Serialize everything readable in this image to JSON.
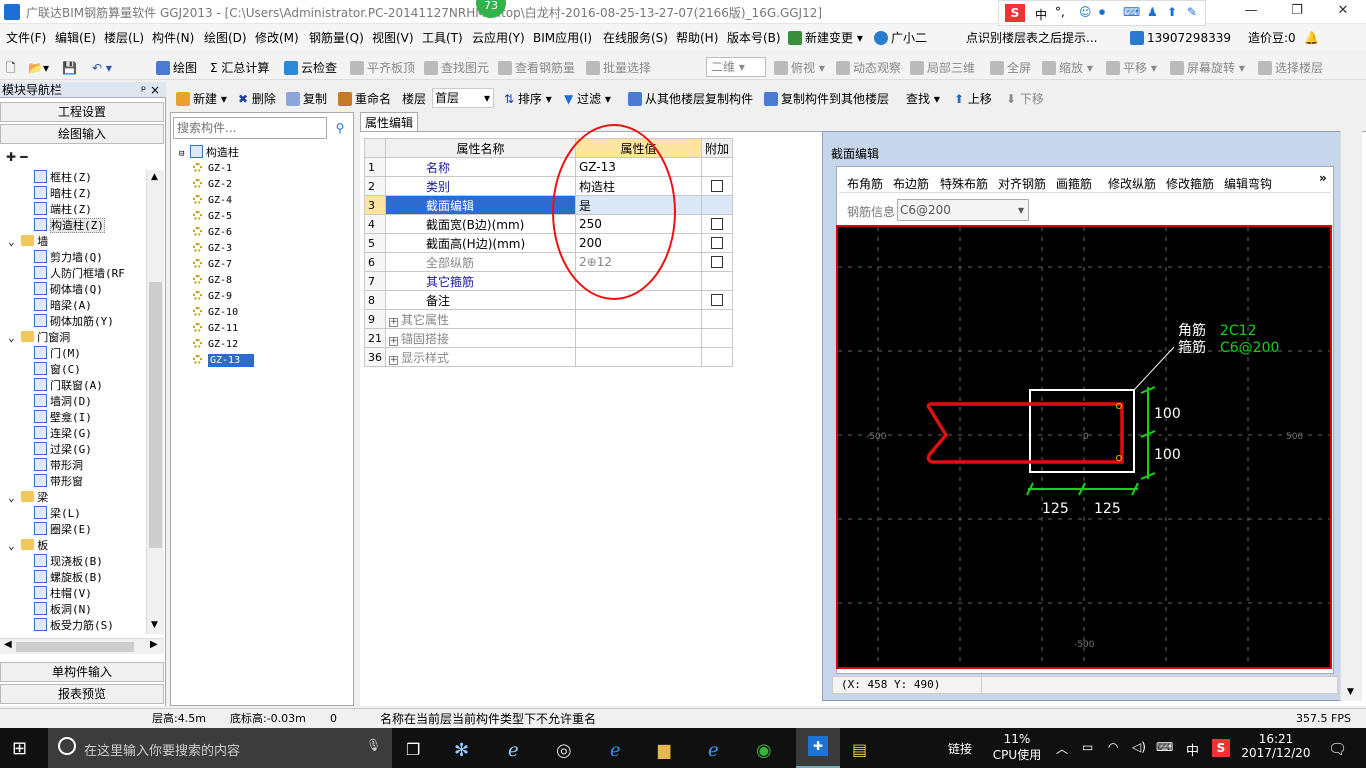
{
  "window": {
    "title": "广联达BIM钢筋算量软件 GGJ2013 - [C:\\Users\\Administrator.PC-20141127NRHM\\...top\\白龙村-2016-08-25-13-27-07(2166版)_16G.GGJ12]",
    "badge": "73",
    "min": "—",
    "restore": "❐",
    "close": "✕"
  },
  "menu": [
    "文件(F)",
    "编辑(E)",
    "楼层(L)",
    "构件(N)",
    "绘图(D)",
    "修改(M)",
    "钢筋量(Q)",
    "视图(V)",
    "工具(T)",
    "云应用(Y)",
    "BIM应用(I)",
    "在线服务(S)",
    "帮助(H)",
    "版本号(B)",
    "新建变更",
    "广小二",
    "点识别楼层表之后提示...",
    "13907298339",
    "造价豆:0"
  ],
  "ime": {
    "brand": "S",
    "lang": "中",
    "punct": "°,"
  },
  "toolbar1": [
    "绘图",
    "Σ 汇总计算",
    "云检查",
    "平齐板顶",
    "查找图元",
    "查看钢筋量",
    "批量选择",
    "二维",
    "俯视",
    "动态观察",
    "局部三维",
    "全屏",
    "缩放",
    "平移",
    "屏幕旋转",
    "选择楼层"
  ],
  "toolbar2": [
    "新建",
    "删除",
    "复制",
    "重命名",
    "楼层",
    "首层",
    "排序",
    "过滤",
    "从其他楼层复制构件",
    "复制构件到其他楼层",
    "查找",
    "上移",
    "下移"
  ],
  "nav": {
    "title": "模块导航栏",
    "pin": "ᵖ ×",
    "btn_settings": "工程设置",
    "btn_draw": "绘图输入",
    "btn_single": "单构件输入",
    "btn_report": "报表预览",
    "tree": [
      {
        "label": "框柱(Z)",
        "level": 2,
        "icon": "column-icon"
      },
      {
        "label": "暗柱(Z)",
        "level": 2,
        "icon": "column-icon"
      },
      {
        "label": "端柱(Z)",
        "level": 2,
        "icon": "column-icon"
      },
      {
        "label": "构造柱(Z)",
        "level": 2,
        "icon": "column-icon",
        "selected": true
      },
      {
        "label": "墙",
        "level": 1,
        "icon": "folder-icon"
      },
      {
        "label": "剪力墙(Q)",
        "level": 2,
        "icon": "wall-icon"
      },
      {
        "label": "人防门框墙(RF",
        "level": 2,
        "icon": "wall-icon"
      },
      {
        "label": "砌体墙(Q)",
        "level": 2,
        "icon": "wall-icon"
      },
      {
        "label": "暗梁(A)",
        "level": 2,
        "icon": "beam-icon"
      },
      {
        "label": "砌体加筋(Y)",
        "level": 2,
        "icon": "rebar-icon"
      },
      {
        "label": "门窗洞",
        "level": 1,
        "icon": "folder-icon"
      },
      {
        "label": "门(M)",
        "level": 2,
        "icon": "door-icon"
      },
      {
        "label": "窗(C)",
        "level": 2,
        "icon": "window-icon"
      },
      {
        "label": "门联窗(A)",
        "level": 2,
        "icon": "door-icon"
      },
      {
        "label": "墙洞(D)",
        "level": 2,
        "icon": "opening-icon"
      },
      {
        "label": "壁龛(I)",
        "level": 2,
        "icon": "opening-icon"
      },
      {
        "label": "连梁(G)",
        "level": 2,
        "icon": "beam-icon"
      },
      {
        "label": "过梁(G)",
        "level": 2,
        "icon": "beam-icon"
      },
      {
        "label": "带形洞",
        "level": 2,
        "icon": "opening-icon"
      },
      {
        "label": "带形窗",
        "level": 2,
        "icon": "window-icon"
      },
      {
        "label": "梁",
        "level": 1,
        "icon": "folder-icon"
      },
      {
        "label": "梁(L)",
        "level": 2,
        "icon": "beam-icon"
      },
      {
        "label": "圈梁(E)",
        "level": 2,
        "icon": "beam-icon"
      },
      {
        "label": "板",
        "level": 1,
        "icon": "folder-icon"
      },
      {
        "label": "现浇板(B)",
        "level": 2,
        "icon": "slab-icon"
      },
      {
        "label": "螺旋板(B)",
        "level": 2,
        "icon": "slab-icon"
      },
      {
        "label": "柱帽(V)",
        "level": 2,
        "icon": "column-icon"
      },
      {
        "label": "板洞(N)",
        "level": 2,
        "icon": "opening-icon"
      },
      {
        "label": "板受力筋(S)",
        "level": 2,
        "icon": "rebar-icon"
      }
    ]
  },
  "components": {
    "search_placeholder": "搜索构件...",
    "root": "构造柱",
    "items": [
      "GZ-1",
      "GZ-2",
      "GZ-4",
      "GZ-5",
      "GZ-6",
      "GZ-3",
      "GZ-7",
      "GZ-8",
      "GZ-9",
      "GZ-10",
      "GZ-11",
      "GZ-12",
      "GZ-13"
    ],
    "selected": "GZ-13"
  },
  "props": {
    "tab": "属性编辑",
    "col_name": "属性名称",
    "col_value": "属性值",
    "col_add": "附加",
    "rows": [
      {
        "no": "1",
        "name": "名称",
        "value": "GZ-13",
        "blue": true,
        "check": false
      },
      {
        "no": "2",
        "name": "类别",
        "value": "构造柱",
        "blue": true,
        "check": true
      },
      {
        "no": "3",
        "name": "截面编辑",
        "value": "是",
        "blue": true,
        "check": false,
        "selected": true
      },
      {
        "no": "4",
        "name": "截面宽(B边)(mm)",
        "value": "250",
        "blue": false,
        "check": true
      },
      {
        "no": "5",
        "name": "截面高(H边)(mm)",
        "value": "200",
        "blue": false,
        "check": true
      },
      {
        "no": "6",
        "name": "全部纵筋",
        "value": "2⊕12",
        "blue": false,
        "gray": true,
        "check": true
      },
      {
        "no": "7",
        "name": "其它箍筋",
        "value": "",
        "blue": true,
        "check": false
      },
      {
        "no": "8",
        "name": "备注",
        "value": "",
        "blue": false,
        "check": true
      },
      {
        "no": "9",
        "name": "其它属性",
        "value": "",
        "expand": true
      },
      {
        "no": "21",
        "name": "锚固搭接",
        "value": "",
        "expand": true
      },
      {
        "no": "36",
        "name": "显示样式",
        "value": "",
        "expand": true
      }
    ]
  },
  "section": {
    "title": "截面编辑",
    "tools": [
      "布角筋",
      "布边筋",
      "特殊布筋",
      "对齐钢筋",
      "画箍筋",
      "修改纵筋",
      "修改箍筋",
      "编辑弯钩"
    ],
    "rebar_label": "钢筋信息",
    "rebar_value": "C6@200",
    "corner_label": "角筋",
    "corner_value": "2C12",
    "stirrup_label": "箍筋",
    "stirrup_value": "C6@200",
    "dim_h1": "100",
    "dim_h2": "100",
    "dim_w1": "125",
    "dim_w2": "125",
    "axis_left": "-500",
    "axis_right": "500",
    "axis_bottom": "-500",
    "axis_zero": "0",
    "coords": "(X: 458 Y: 490)",
    "more": "»"
  },
  "status": {
    "floor_height": "层高:4.5m",
    "base_height": "底标高:-0.03m",
    "zero": "0",
    "message": "名称在当前层当前构件类型下不允许重名",
    "fps": "357.5 FPS"
  },
  "taskbar": {
    "search": "在这里输入你要搜索的内容",
    "network": "链接",
    "cpu_pct": "11%",
    "cpu_label": "CPU使用",
    "lang": "中",
    "time": "16:21",
    "date": "2017/12/20"
  },
  "colors": {
    "accent": "#2e6bd0",
    "stirrup": "#e01010",
    "dim": "#19d019",
    "canvas": "#000000"
  }
}
